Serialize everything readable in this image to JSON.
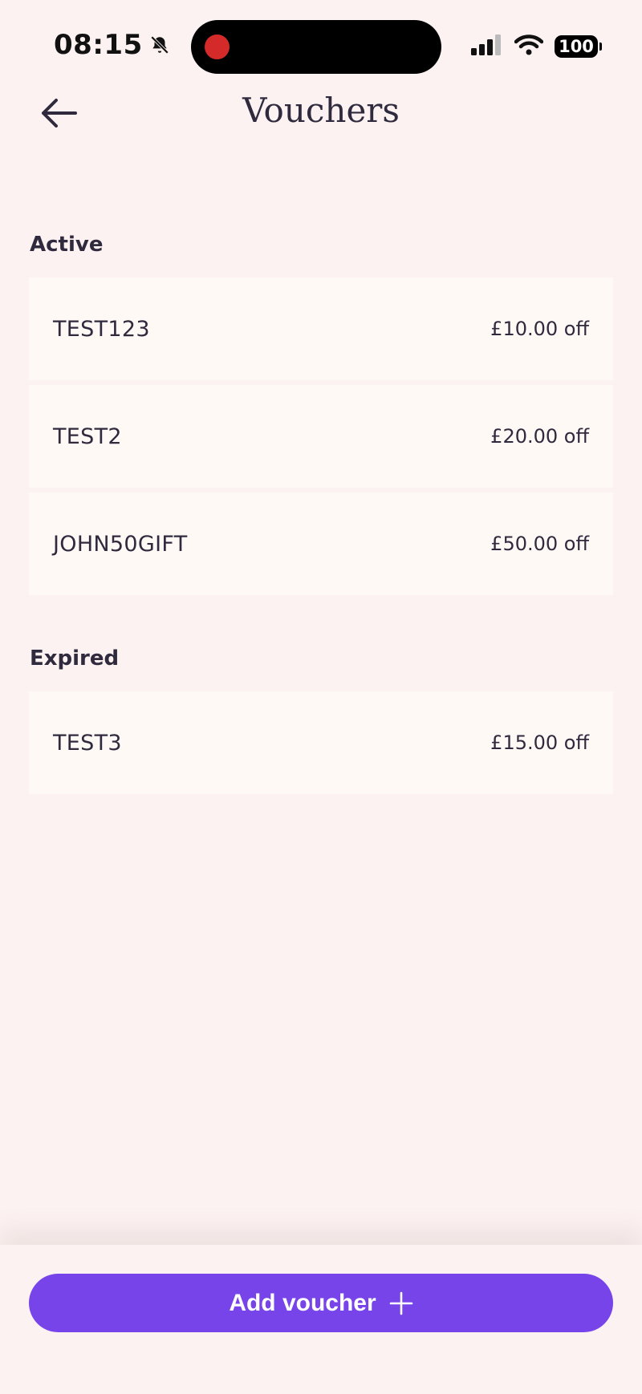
{
  "status_bar": {
    "time": "08:15",
    "battery": "100"
  },
  "header": {
    "title": "Vouchers"
  },
  "sections": {
    "active": {
      "heading": "Active",
      "vouchers": [
        {
          "code": "TEST123",
          "amount": "£10.00 off"
        },
        {
          "code": "TEST2",
          "amount": "£20.00 off"
        },
        {
          "code": "JOHN50GIFT",
          "amount": "£50.00 off"
        }
      ]
    },
    "expired": {
      "heading": "Expired",
      "vouchers": [
        {
          "code": "TEST3",
          "amount": "£15.00 off"
        }
      ]
    }
  },
  "footer": {
    "add_label": "Add voucher"
  },
  "colors": {
    "background": "#fcf2f1",
    "card": "#fff9f6",
    "accent": "#7744ea",
    "text": "#2f2a3d",
    "recording": "#d42a2a"
  },
  "icons": {
    "back": "arrow-left-icon",
    "add": "plus-icon",
    "bell": "bell-slash-icon",
    "signal": "cellular-signal-icon",
    "wifi": "wifi-icon",
    "battery": "battery-icon"
  }
}
